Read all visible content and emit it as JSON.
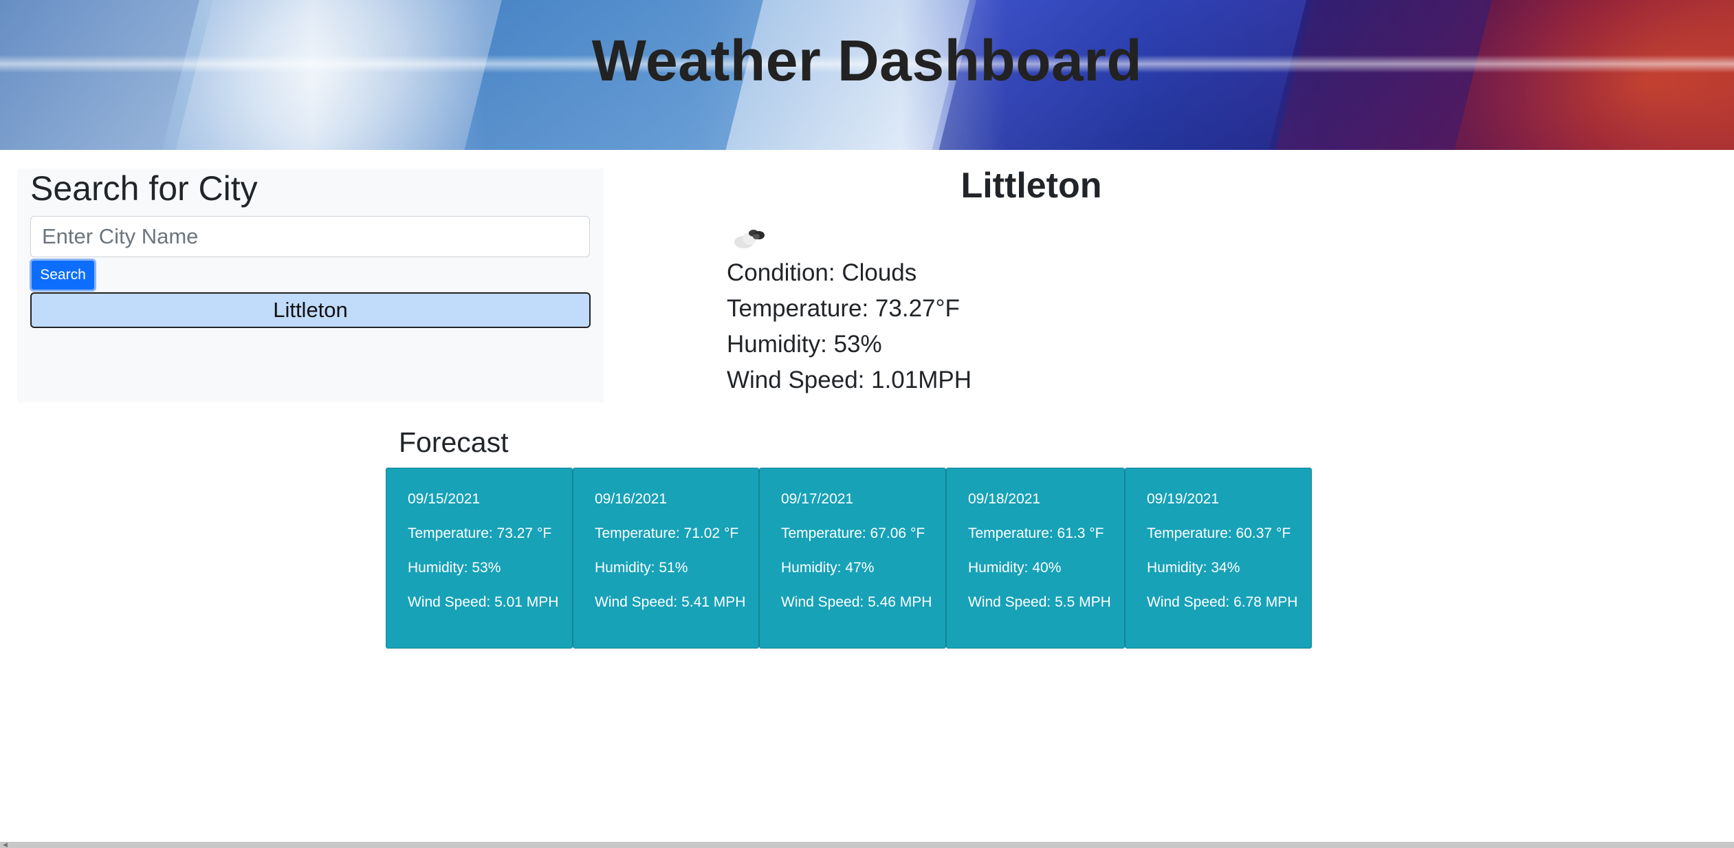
{
  "header": {
    "title": "Weather Dashboard"
  },
  "search": {
    "heading": "Search for City",
    "placeholder": "Enter City Name",
    "value": "",
    "button_label": "Search",
    "history": [
      "Littleton"
    ]
  },
  "current": {
    "city": "Littleton",
    "icon": "clouds-icon",
    "condition": "Condition: Clouds",
    "temperature": "Temperature: 73.27°F",
    "humidity": "Humidity: 53%",
    "wind": "Wind Speed: 1.01MPH"
  },
  "forecast": {
    "title": "Forecast",
    "days": [
      {
        "date": "09/15/2021",
        "temp": "Temperature: 73.27 °F",
        "humidity": "Humidity: 53%",
        "wind": "Wind Speed: 5.01 MPH"
      },
      {
        "date": "09/16/2021",
        "temp": "Temperature: 71.02 °F",
        "humidity": "Humidity: 51%",
        "wind": "Wind Speed: 5.41 MPH"
      },
      {
        "date": "09/17/2021",
        "temp": "Temperature: 67.06 °F",
        "humidity": "Humidity: 47%",
        "wind": "Wind Speed: 5.46 MPH"
      },
      {
        "date": "09/18/2021",
        "temp": "Temperature: 61.3 °F",
        "humidity": "Humidity: 40%",
        "wind": "Wind Speed: 5.5 MPH"
      },
      {
        "date": "09/19/2021",
        "temp": "Temperature: 60.37 °F",
        "humidity": "Humidity: 34%",
        "wind": "Wind Speed: 6.78 MPH"
      }
    ]
  },
  "colors": {
    "search_button": "#0d6efd",
    "history_button": "#c1dbfa",
    "forecast_card": "#17a2b8",
    "panel_background": "#f8f9fa"
  }
}
